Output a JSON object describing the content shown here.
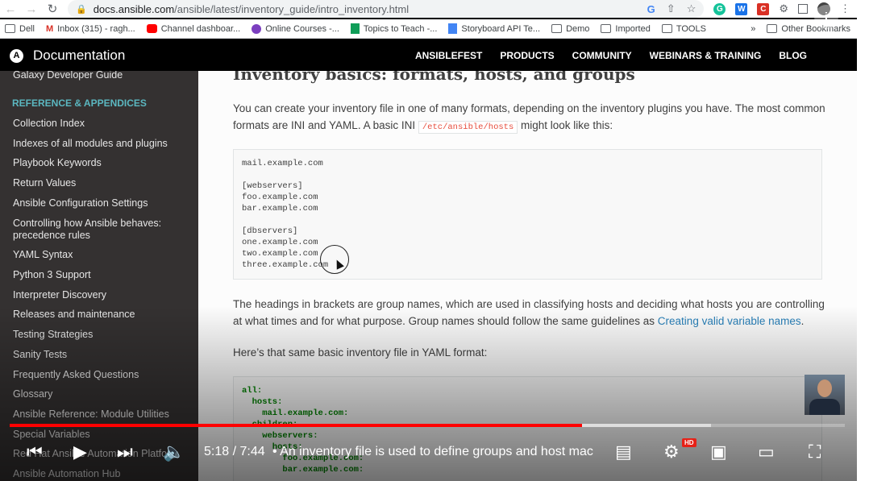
{
  "browser": {
    "url_host": "docs.ansible.com",
    "url_path": "/ansible/latest/inventory_guide/intro_inventory.html",
    "bookmarks": [
      {
        "label": "Dell",
        "icon": "folder-icon"
      },
      {
        "label": "Inbox (315) - ragh...",
        "icon": "gmail-icon"
      },
      {
        "label": "Channel dashboar...",
        "icon": "youtube-icon"
      },
      {
        "label": "Online Courses -...",
        "icon": "course-icon"
      },
      {
        "label": "Topics to Teach -...",
        "icon": "sheets-icon"
      },
      {
        "label": "Storyboard API Te...",
        "icon": "docs-icon"
      },
      {
        "label": "Demo",
        "icon": "folder-icon"
      },
      {
        "label": "Imported",
        "icon": "folder-icon"
      },
      {
        "label": "TOOLS",
        "icon": "folder-icon"
      }
    ],
    "bookmarks_more": "»",
    "other_bookmarks": "Other Bookmarks"
  },
  "docs": {
    "logo_letter": "A",
    "title": "Documentation",
    "nav": [
      "ANSIBLEFEST",
      "PRODUCTS",
      "COMMUNITY",
      "WEBINARS & TRAINING",
      "BLOG"
    ]
  },
  "sidebar": {
    "top_item": "Galaxy Developer Guide",
    "caption": "REFERENCE & APPENDICES",
    "items": [
      "Collection Index",
      "Indexes of all modules and plugins",
      "Playbook Keywords",
      "Return Values",
      "Ansible Configuration Settings",
      "Controlling how Ansible behaves: precedence rules",
      "YAML Syntax",
      "Python 3 Support",
      "Interpreter Discovery",
      "Releases and maintenance",
      "Testing Strategies",
      "Sanity Tests",
      "Frequently Asked Questions",
      "Glossary",
      "Ansible Reference: Module Utilities",
      "Special Variables",
      "Red Hat Ansible Automation Platform",
      "Ansible Automation Hub"
    ]
  },
  "content": {
    "heading": "Inventory basics: formats, hosts, and groups",
    "para1_before": "You can create your inventory file in one of many formats, depending on the inventory plugins you have. The most common formats are INI and YAML. A basic INI ",
    "para1_code": "/etc/ansible/hosts",
    "para1_after": " might look like this:",
    "ini_block": "mail.example.com\n\n[webservers]\nfoo.example.com\nbar.example.com\n\n[dbservers]\none.example.com\ntwo.example.com\nthree.example.com",
    "para2_before": "The headings in brackets are group names, which are used in classifying hosts and deciding what hosts you are controlling at what times and for what purpose. Group names should follow the same guidelines as ",
    "para2_link": "Creating valid variable names",
    "para2_after": ".",
    "para3": "Here’s that same basic inventory file in YAML format:",
    "yaml_lines": [
      {
        "text": "all:",
        "indent": 0
      },
      {
        "text": "hosts:",
        "indent": 1
      },
      {
        "text": "mail.example.com:",
        "indent": 2
      },
      {
        "text": "children:",
        "indent": 1
      },
      {
        "text": "webservers:",
        "indent": 2
      },
      {
        "text": "hosts:",
        "indent": 3
      },
      {
        "text": "foo.example.com:",
        "indent": 4
      },
      {
        "text": "bar.example.com:",
        "indent": 4
      }
    ]
  },
  "player": {
    "time": "5:18 / 7:44",
    "chapter": "• An inventory file is used to define groups and host mac",
    "progress": 0.685,
    "buffered": 0.84,
    "hd_badge": "HD",
    "info_icon": "i",
    "colors": {
      "played": "#ff0000",
      "buffered": "rgba(255,255,255,0.55)",
      "remaining": "rgba(255,255,255,0.25)"
    }
  }
}
